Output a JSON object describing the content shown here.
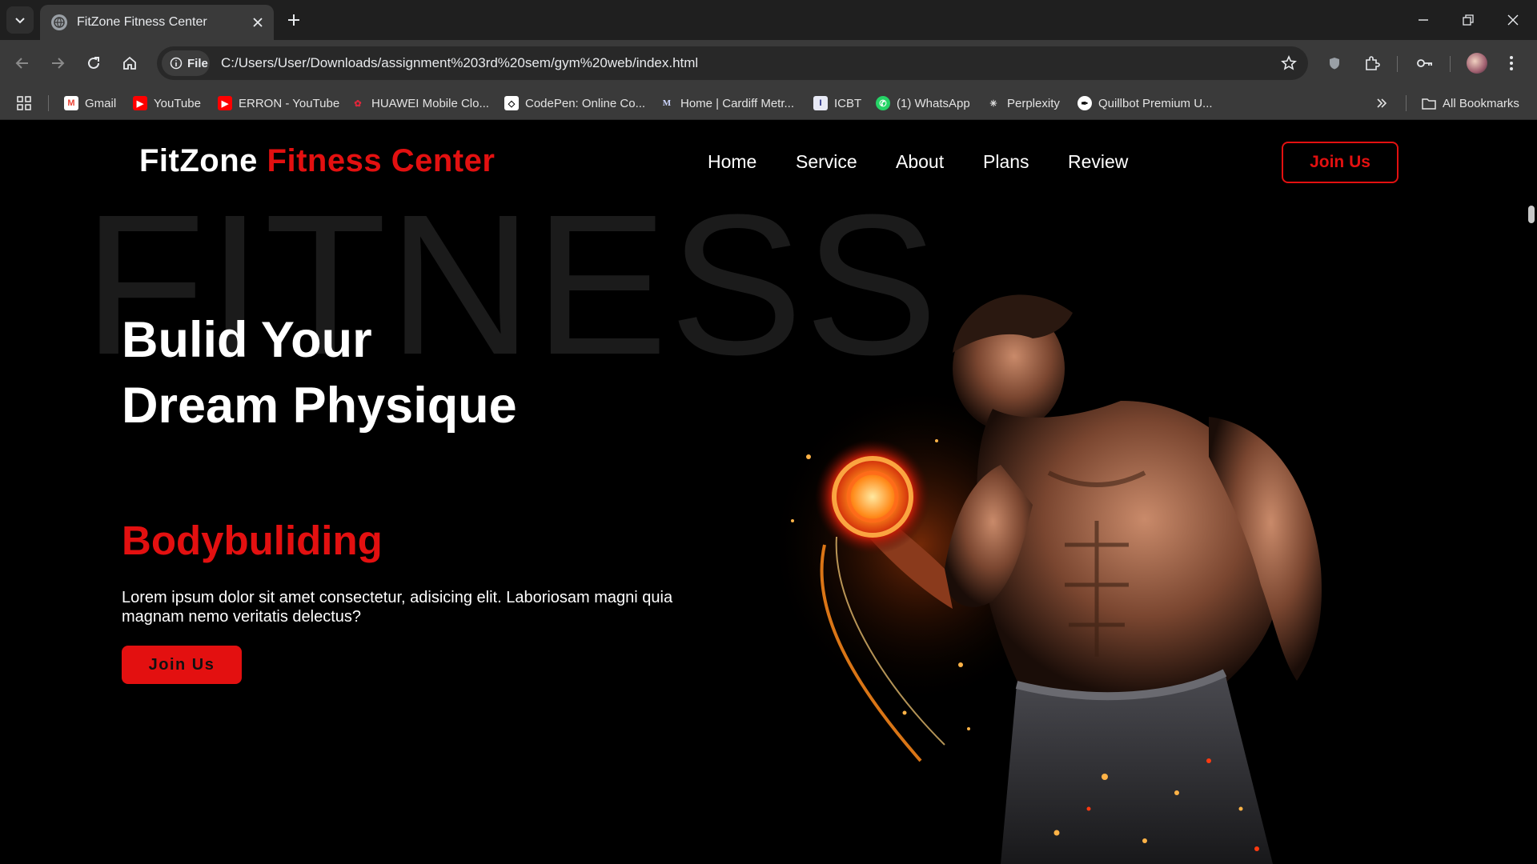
{
  "browser": {
    "tab_title": "FitZone Fitness Center",
    "chip_label": "File",
    "url": "C:/Users/User/Downloads/assignment%203rd%20sem/gym%20web/index.html",
    "bookmarks": [
      {
        "label": "Gmail",
        "icon": "gmail-icon"
      },
      {
        "label": "YouTube",
        "icon": "youtube-icon"
      },
      {
        "label": "ERRON - YouTube",
        "icon": "youtube-icon"
      },
      {
        "label": "HUAWEI Mobile Clo...",
        "icon": "huawei-icon"
      },
      {
        "label": "CodePen: Online Co...",
        "icon": "codepen-icon"
      },
      {
        "label": "Home | Cardiff Metr...",
        "icon": "cardiff-icon"
      },
      {
        "label": "ICBT",
        "icon": "icbt-icon"
      },
      {
        "label": "(1) WhatsApp",
        "icon": "whatsapp-icon"
      },
      {
        "label": "Perplexity",
        "icon": "perplexity-icon"
      },
      {
        "label": "Quillbot Premium U...",
        "icon": "quillbot-icon"
      }
    ],
    "all_bookmarks": "All Bookmarks"
  },
  "site": {
    "logo_white": "FitZone",
    "logo_red": "Fitness Center",
    "nav": [
      "Home",
      "Service",
      "About",
      "Plans",
      "Review"
    ],
    "join_top": "Join Us",
    "watermark": "FITNESS",
    "headline_1": "Bulid Your",
    "headline_2": "Dream Physique",
    "subheadline": "Bodybuliding",
    "description": "Lorem ipsum dolor sit amet consectetur, adisicing elit. Laboriosam magni quia magnam nemo veritatis delectus?",
    "join_main": "Join Us"
  },
  "colors": {
    "accent": "#e31010",
    "background": "#000000",
    "chrome_dark": "#1f1f1f",
    "chrome_mid": "#3a3a3a"
  }
}
